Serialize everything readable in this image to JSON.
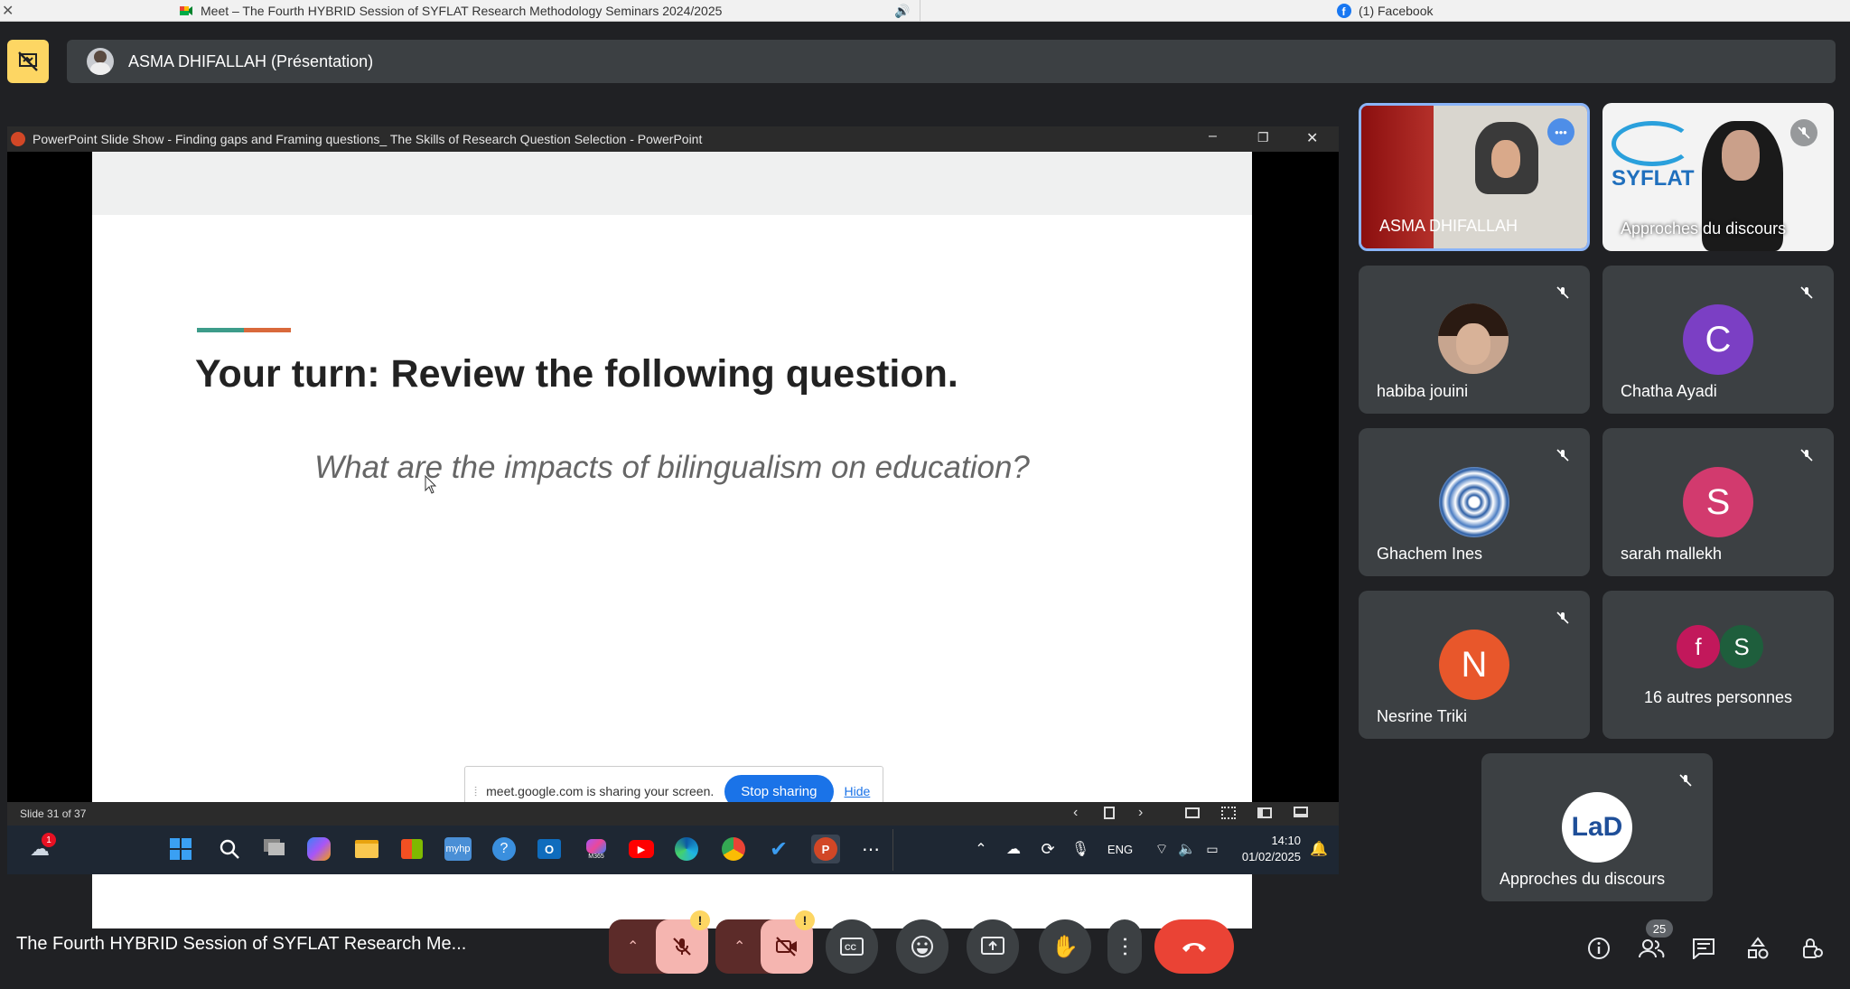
{
  "browser": {
    "tab_meet": "Meet – The Fourth HYBRID Session of SYFLAT Research Methodology Seminars 2024/2025",
    "tab_facebook": "(1) Facebook"
  },
  "presenter": {
    "label": "ASMA DHIFALLAH (Présentation)"
  },
  "ppt": {
    "window_title": "PowerPoint Slide Show  -  Finding gaps and Framing questions_ The Skills of Research Question Selection - PowerPoint",
    "slide_counter": "Slide 31 of 37",
    "slide_title": "Your turn: Review the following question.",
    "slide_question": "What are the impacts of bilingualism on education?",
    "accent_colors": [
      "#3d9c8a",
      "#d9693b"
    ]
  },
  "share_notice": {
    "text": "meet.google.com is sharing your screen.",
    "stop_label": "Stop sharing",
    "hide_label": "Hide"
  },
  "taskbar": {
    "weather_badge": "1",
    "lang": "ENG",
    "time": "14:10",
    "date": "01/02/2025",
    "m365_label": "M365"
  },
  "participants": {
    "p1": "ASMA DHIFALLAH",
    "p2": "Approches du discours",
    "p3": "habiba jouini",
    "p4": "Chatha Ayadi",
    "p5": "Ghachem Ines",
    "p6": "sarah mallekh",
    "p7": "Nesrine Triki",
    "others": "16 autres personnes",
    "p8": "Approches du discours",
    "initial_c": "C",
    "initial_s": "S",
    "initial_n": "N",
    "initial_f": "f",
    "initial_s2": "S"
  },
  "meeting": {
    "title": "The Fourth HYBRID Session of SYFLAT Research Me...",
    "people_count": "25"
  },
  "colors": {
    "end_call": "#ea4335",
    "muted_ctrl": "#f5b5b0",
    "present_btn": "#fdd663",
    "avatar_c": "#7b3fc4",
    "avatar_s": "#d23a6e",
    "avatar_n": "#e8572b"
  }
}
